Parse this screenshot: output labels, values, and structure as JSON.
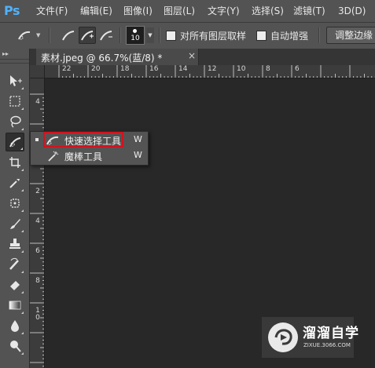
{
  "app": {
    "logo": "Ps"
  },
  "menu": [
    "文件(F)",
    "编辑(E)",
    "图像(I)",
    "图层(L)",
    "文字(Y)",
    "选择(S)",
    "滤镜(T)",
    "3D(D)"
  ],
  "options": {
    "brush_size": "10",
    "sample_all_layers_label": "对所有图层取样",
    "auto_enhance_label": "自动增强",
    "refine_edge_label": "调整边缘"
  },
  "document": {
    "tab_title": "素材.jpeg @ 66.7%(蓝/8) *",
    "close": "×"
  },
  "ruler": {
    "top": [
      "22",
      "20",
      "18",
      "16",
      "14",
      "12",
      "10",
      "8",
      "6"
    ],
    "left": [
      "4",
      "2",
      "2",
      "4",
      "6",
      "8",
      "1\n0"
    ]
  },
  "flyout": {
    "items": [
      {
        "label": "快速选择工具",
        "shortcut": "W",
        "icon": "quick-selection-icon",
        "selected": true
      },
      {
        "label": "魔棒工具",
        "shortcut": "W",
        "icon": "magic-wand-icon",
        "selected": false
      }
    ]
  },
  "watermark": {
    "title": "溜溜自学",
    "url": "ZIXUE.3066.COM"
  },
  "colors": {
    "highlight": "#d4121d",
    "ps_logo": "#4fb2ff",
    "panel": "#535353",
    "canvas": "#282828"
  }
}
